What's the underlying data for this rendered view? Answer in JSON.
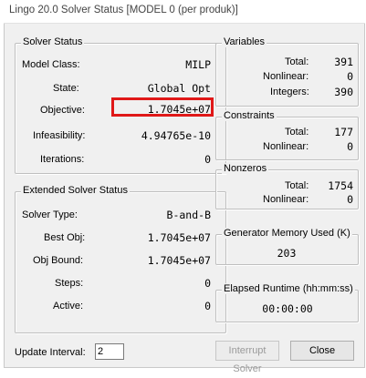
{
  "window": {
    "title": "Lingo 20.0 Solver Status [MODEL 0 (per produk)]"
  },
  "solver_status": {
    "title": "Solver Status",
    "model_class_label": "Model Class:",
    "model_class": "MILP",
    "state_label": "State:",
    "state": "Global Opt",
    "objective_label": "Objective:",
    "objective": "1.7045e+07",
    "infeasibility_label": "Infeasibility:",
    "infeasibility": "4.94765e-10",
    "iterations_label": "Iterations:",
    "iterations": "0"
  },
  "extended_status": {
    "title": "Extended Solver Status",
    "solver_type_label": "Solver Type:",
    "solver_type": "B-and-B",
    "best_obj_label": "Best Obj:",
    "best_obj": "1.7045e+07",
    "obj_bound_label": "Obj Bound:",
    "obj_bound": "1.7045e+07",
    "steps_label": "Steps:",
    "steps": "0",
    "active_label": "Active:",
    "active": "0"
  },
  "variables": {
    "title": "Variables",
    "total_label": "Total:",
    "total": "391",
    "nonlinear_label": "Nonlinear:",
    "nonlinear": "0",
    "integers_label": "Integers:",
    "integers": "390"
  },
  "constraints": {
    "title": "Constraints",
    "total_label": "Total:",
    "total": "177",
    "nonlinear_label": "Nonlinear:",
    "nonlinear": "0"
  },
  "nonzeros": {
    "title": "Nonzeros",
    "total_label": "Total:",
    "total": "1754",
    "nonlinear_label": "Nonlinear:",
    "nonlinear": "0"
  },
  "memory": {
    "title": "Generator Memory Used (K)",
    "value": "203"
  },
  "runtime": {
    "title": "Elapsed Runtime (hh:mm:ss)",
    "value": "00:00:00"
  },
  "footer": {
    "update_interval_label": "Update Interval:",
    "update_interval_value": "2",
    "interrupt_label": "Interrupt Solver",
    "close_label": "Close"
  },
  "colors": {
    "highlight": "#e01818",
    "background": "#f0f0f0"
  }
}
